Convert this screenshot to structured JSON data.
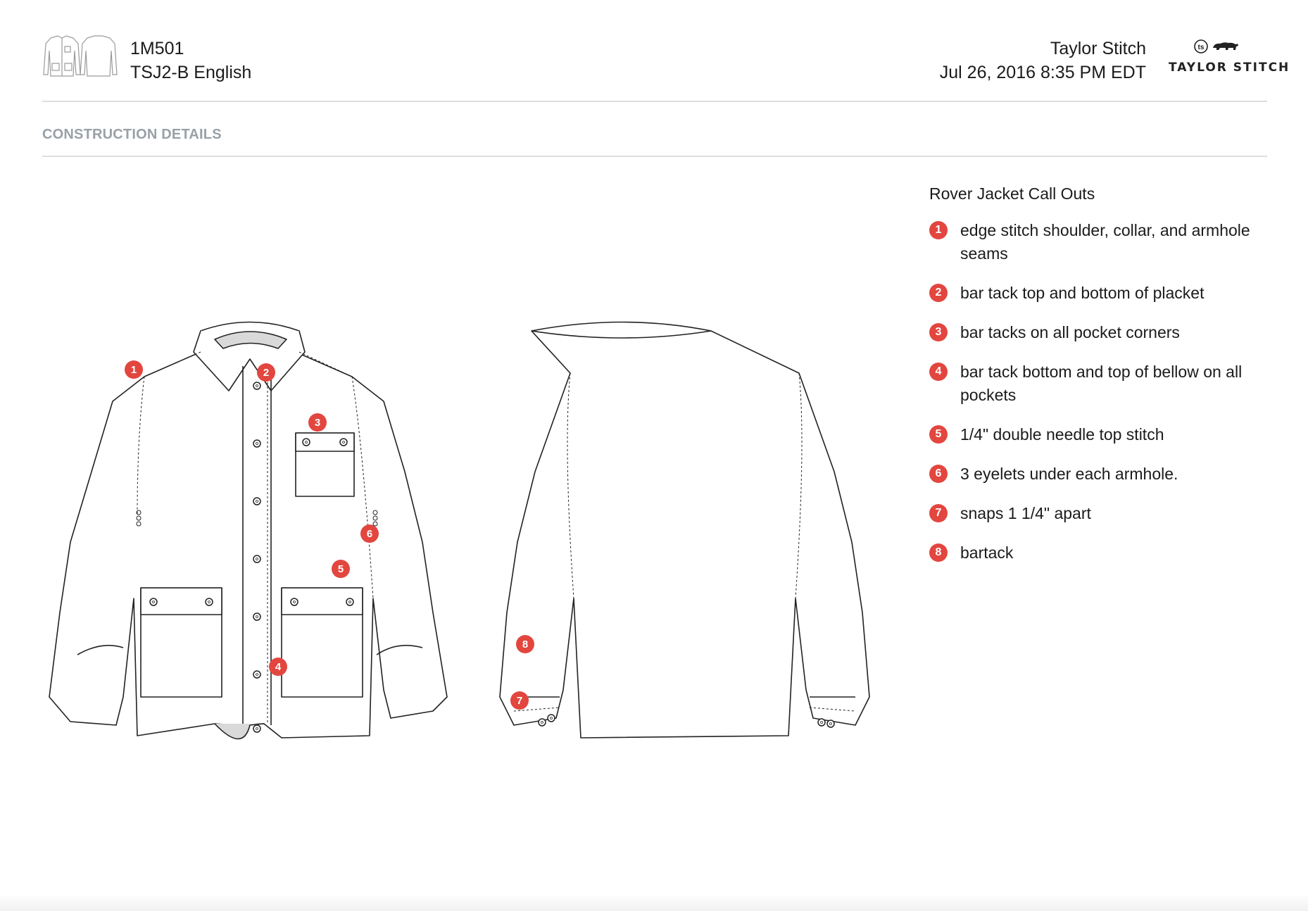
{
  "header": {
    "style_number": "1M501",
    "style_name": "TSJ2-B English",
    "company": "Taylor Stitch",
    "timestamp": "Jul 26, 2016 8:35 PM EDT",
    "logo_monogram": "ts",
    "logo_text": "TAYLOR STITCH"
  },
  "section": {
    "title": "CONSTRUCTION DETAILS"
  },
  "callouts": {
    "title": "Rover Jacket Call Outs",
    "items": [
      {
        "num": "1",
        "text": "edge stitch shoulder, collar, and armhole seams"
      },
      {
        "num": "2",
        "text": "bar tack top and bottom of placket"
      },
      {
        "num": "3",
        "text": "bar tacks on all pocket corners"
      },
      {
        "num": "4",
        "text": "bar tack bottom and top of bellow on all pockets"
      },
      {
        "num": "5",
        "text": "1/4\" double needle top stitch"
      },
      {
        "num": "6",
        "text": "3 eyelets under each armhole."
      },
      {
        "num": "7",
        "text": "snaps 1 1/4\" apart"
      },
      {
        "num": "8",
        "text": "bartack"
      }
    ]
  },
  "drawing_markers": {
    "front": [
      "1",
      "2",
      "3",
      "4",
      "5",
      "6"
    ],
    "back": [
      "7",
      "8"
    ]
  },
  "colors": {
    "accent_red": "#e2463f",
    "section_gray": "#9aa0a6",
    "rule_gray": "#dedede",
    "line": "#222222"
  }
}
